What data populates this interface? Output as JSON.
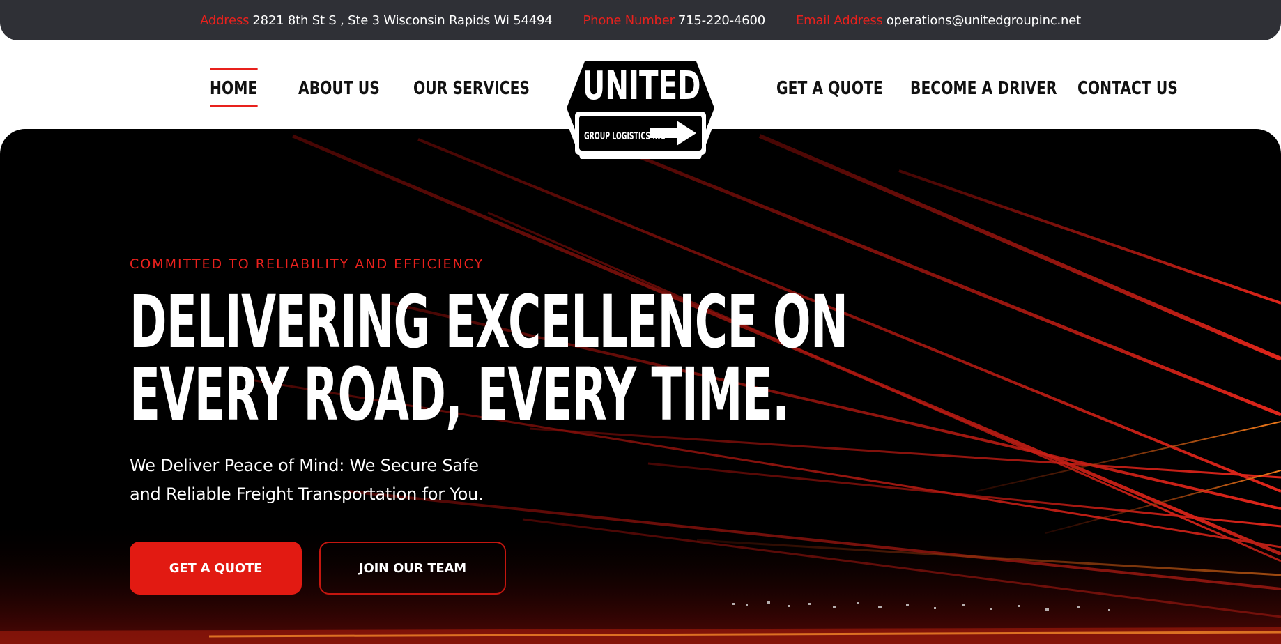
{
  "topbar": {
    "address_label": "Address",
    "address_value": "2821 8th St S , Ste 3 Wisconsin Rapids Wi 54494",
    "phone_label": "Phone Number",
    "phone_value": "715-220-4600",
    "email_label": "Email Address",
    "email_value": "operations@unitedgroupinc.net"
  },
  "nav": {
    "home": "HOME",
    "about": "ABOUT US",
    "services": "OUR SERVICES",
    "quote": "GET A QUOTE",
    "driver": "BECOME A DRIVER",
    "contact": "CONTACT US"
  },
  "logo": {
    "title": "UNITED",
    "subtitle": "GROUP LOGISTICS INC",
    "icon": "arrow-right-icon"
  },
  "hero": {
    "tagline": "COMMITTED TO RELIABILITY AND EFFICIENCY",
    "headline_line1": "DELIVERING EXCELLENCE ON",
    "headline_line2": "EVERY ROAD, EVERY TIME.",
    "sub_line1": "We Deliver Peace of Mind: We Secure Safe",
    "sub_line2": "and Reliable Freight Transportation for You.",
    "primary_button": "GET A QUOTE",
    "secondary_button": "JOIN OUR TEAM"
  },
  "colors": {
    "accent": "#e8211d",
    "topbar_bg": "#2f3036",
    "hero_bg": "#000000",
    "text_dark": "#111111"
  }
}
